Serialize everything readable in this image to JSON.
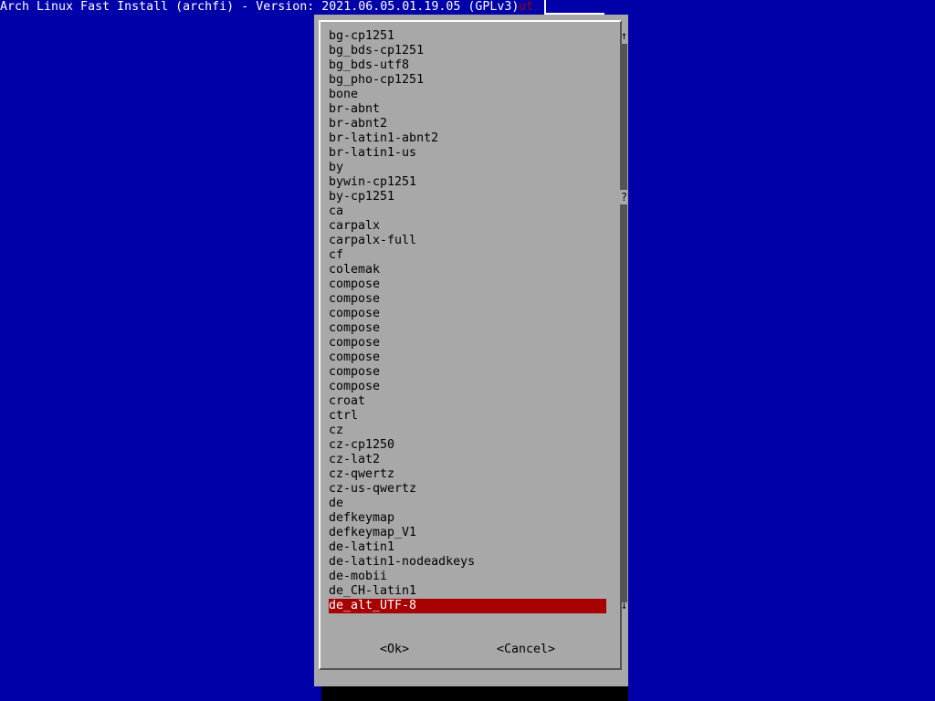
{
  "backtitle": "Arch Linux Fast Install (archfi) - Version: 2021.06.05.01.19.05 (GPLv3)",
  "under_dialog_text": "ut",
  "list": {
    "items": [
      "bg-cp1251",
      "bg_bds-cp1251",
      "bg_bds-utf8",
      "bg_pho-cp1251",
      "bone",
      "br-abnt",
      "br-abnt2",
      "br-latin1-abnt2",
      "br-latin1-us",
      "by",
      "bywin-cp1251",
      "by-cp1251",
      "ca",
      "carpalx",
      "carpalx-full",
      "cf",
      "colemak",
      "compose",
      "compose",
      "compose",
      "compose",
      "compose",
      "compose",
      "compose",
      "compose",
      "croat",
      "ctrl",
      "cz",
      "cz-cp1250",
      "cz-lat2",
      "cz-qwertz",
      "cz-us-qwertz",
      "de",
      "defkeymap",
      "defkeymap_V1",
      "de-latin1",
      "de-latin1-nodeadkeys",
      "de-mobii",
      "de_CH-latin1",
      "de_alt_UTF-8"
    ],
    "selected_index": 39
  },
  "scrollbar": {
    "up": "↑",
    "thumb": "?",
    "down": "↓"
  },
  "buttons": {
    "ok": "<Ok>",
    "cancel": "<Cancel>"
  },
  "colors": {
    "background": "#0000a8",
    "dialog": "#a8a8a8",
    "selection": "#a80000"
  }
}
